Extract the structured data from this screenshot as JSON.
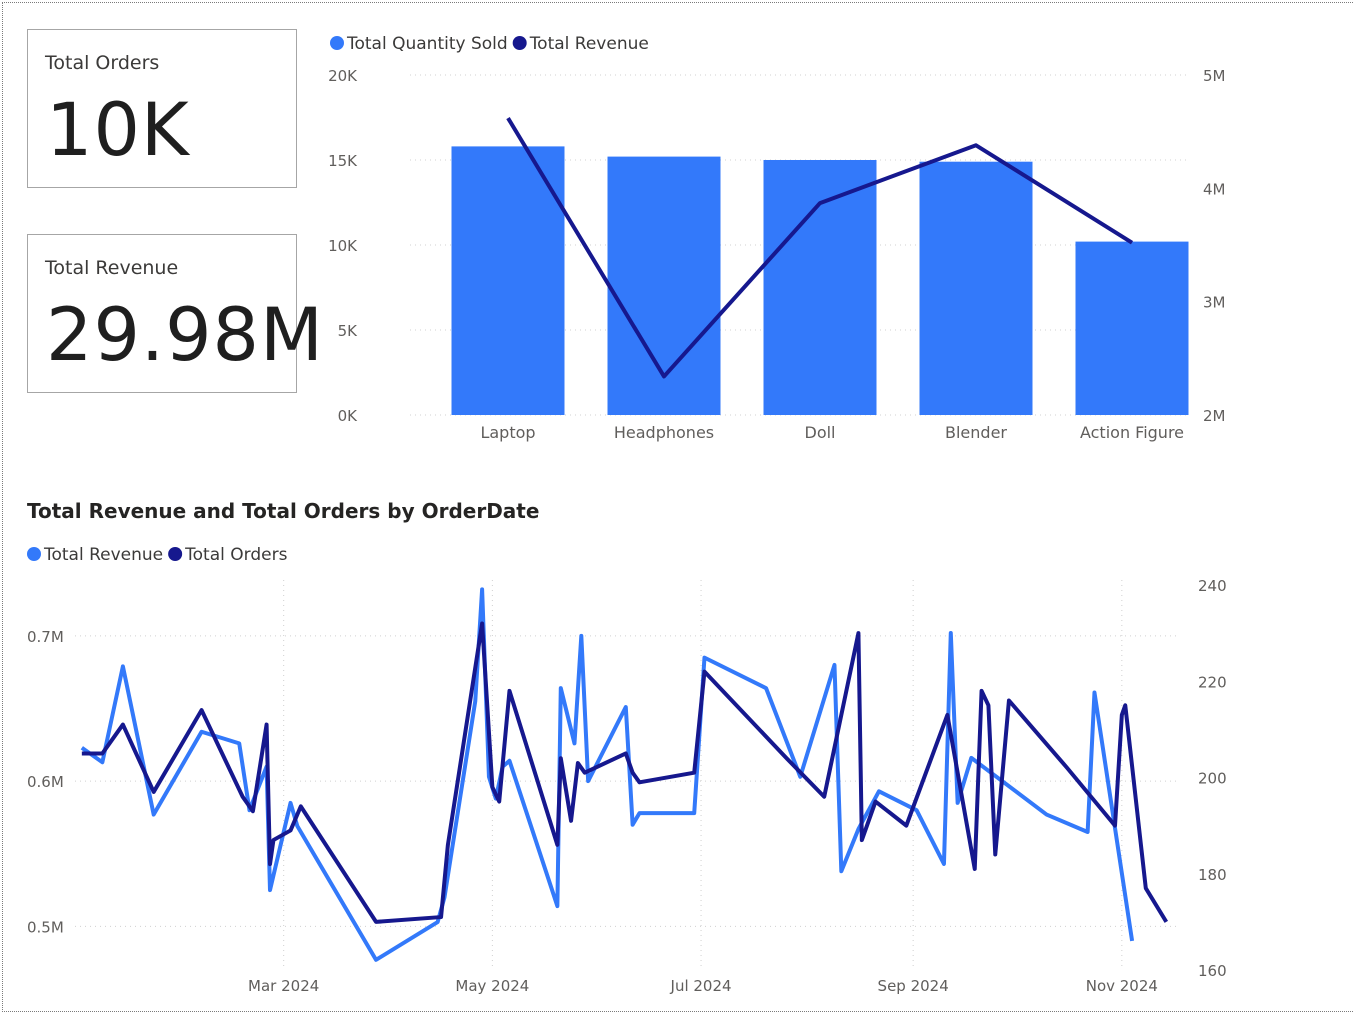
{
  "cards": {
    "orders": {
      "title": "Total Orders",
      "value": "10K"
    },
    "revenue": {
      "title": "Total Revenue",
      "value": "29.98M"
    }
  },
  "colors": {
    "light_blue": "#3379FA",
    "dark_navy": "#16188E"
  },
  "chart_data": [
    {
      "type": "bar",
      "title": "",
      "categories": [
        "Laptop",
        "Headphones",
        "Doll",
        "Blender",
        "Action Figure"
      ],
      "series": [
        {
          "name": "Total Quantity Sold",
          "type": "bar",
          "axis": "left",
          "color": "#3379FA",
          "values": [
            15800,
            15200,
            15000,
            14900,
            10200
          ]
        },
        {
          "name": "Total Revenue",
          "type": "line",
          "axis": "right",
          "color": "#16188E",
          "values": [
            4620000,
            2340000,
            3870000,
            4380000,
            3520000
          ]
        }
      ],
      "y_left": {
        "ticks": [
          "0K",
          "5K",
          "10K",
          "15K",
          "20K"
        ],
        "ylim": [
          0,
          20000
        ]
      },
      "y_right": {
        "ticks": [
          "2M",
          "3M",
          "4M",
          "5M"
        ],
        "ylim": [
          2000000,
          5000000
        ]
      },
      "legend": "top-left",
      "grid": true
    },
    {
      "type": "line",
      "title": "Total Revenue and Total Orders by OrderDate",
      "x_ticks": [
        "Mar 2024",
        "May 2024",
        "Jul 2024",
        "Sep 2024",
        "Nov 2024"
      ],
      "x_tick_dates": [
        "2024-03-01",
        "2024-05-01",
        "2024-07-01",
        "2024-09-01",
        "2024-11-01"
      ],
      "y_left": {
        "ticks": [
          "0.5M",
          "0.6M",
          "0.7M"
        ],
        "ylim": [
          0.47,
          0.735
        ],
        "unit": "M"
      },
      "y_right": {
        "ticks": [
          "160",
          "180",
          "200",
          "220",
          "240"
        ],
        "ylim": [
          160,
          240
        ]
      },
      "legend": "top-left",
      "grid": true,
      "series": [
        {
          "name": "Total Revenue",
          "axis": "left",
          "color": "#3379FA",
          "points": [
            [
              "2024-01-02",
              0.623
            ],
            [
              "2024-01-08",
              0.613
            ],
            [
              "2024-01-14",
              0.679
            ],
            [
              "2024-01-23",
              0.577
            ],
            [
              "2024-02-06",
              0.634
            ],
            [
              "2024-02-17",
              0.626
            ],
            [
              "2024-02-20",
              0.58
            ],
            [
              "2024-02-25",
              0.61
            ],
            [
              "2024-02-26",
              0.525
            ],
            [
              "2024-03-03",
              0.585
            ],
            [
              "2024-03-05",
              0.569
            ],
            [
              "2024-03-28",
              0.477
            ],
            [
              "2024-04-15",
              0.503
            ],
            [
              "2024-04-17",
              0.52
            ],
            [
              "2024-04-26",
              0.655
            ],
            [
              "2024-04-28",
              0.732
            ],
            [
              "2024-04-30",
              0.603
            ],
            [
              "2024-05-02",
              0.588
            ],
            [
              "2024-05-04",
              0.61
            ],
            [
              "2024-05-06",
              0.614
            ],
            [
              "2024-05-20",
              0.514
            ],
            [
              "2024-05-21",
              0.664
            ],
            [
              "2024-05-25",
              0.626
            ],
            [
              "2024-05-27",
              0.7
            ],
            [
              "2024-05-29",
              0.6
            ],
            [
              "2024-06-09",
              0.651
            ],
            [
              "2024-06-11",
              0.57
            ],
            [
              "2024-06-13",
              0.578
            ],
            [
              "2024-06-29",
              0.578
            ],
            [
              "2024-07-02",
              0.685
            ],
            [
              "2024-07-20",
              0.664
            ],
            [
              "2024-07-30",
              0.603
            ],
            [
              "2024-08-09",
              0.68
            ],
            [
              "2024-08-11",
              0.538
            ],
            [
              "2024-08-16",
              0.567
            ],
            [
              "2024-08-22",
              0.593
            ],
            [
              "2024-09-02",
              0.58
            ],
            [
              "2024-09-10",
              0.543
            ],
            [
              "2024-09-12",
              0.702
            ],
            [
              "2024-09-14",
              0.585
            ],
            [
              "2024-09-18",
              0.616
            ],
            [
              "2024-10-10",
              0.577
            ],
            [
              "2024-10-22",
              0.565
            ],
            [
              "2024-10-24",
              0.661
            ],
            [
              "2024-11-04",
              0.49
            ]
          ]
        },
        {
          "name": "Total Orders",
          "axis": "right",
          "color": "#16188E",
          "points": [
            [
              "2024-01-02",
              205
            ],
            [
              "2024-01-08",
              205
            ],
            [
              "2024-01-14",
              211
            ],
            [
              "2024-01-23",
              197
            ],
            [
              "2024-02-06",
              214
            ],
            [
              "2024-02-18",
              196
            ],
            [
              "2024-02-21",
              193
            ],
            [
              "2024-02-25",
              211
            ],
            [
              "2024-02-26",
              182
            ],
            [
              "2024-02-27",
              187
            ],
            [
              "2024-03-03",
              189
            ],
            [
              "2024-03-06",
              194
            ],
            [
              "2024-03-28",
              170
            ],
            [
              "2024-04-16",
              171
            ],
            [
              "2024-04-18",
              186
            ],
            [
              "2024-04-28",
              232
            ],
            [
              "2024-05-01",
              198
            ],
            [
              "2024-05-03",
              195
            ],
            [
              "2024-05-06",
              218
            ],
            [
              "2024-05-20",
              186
            ],
            [
              "2024-05-21",
              204
            ],
            [
              "2024-05-24",
              191
            ],
            [
              "2024-05-26",
              203
            ],
            [
              "2024-05-28",
              201
            ],
            [
              "2024-06-09",
              205
            ],
            [
              "2024-06-11",
              201
            ],
            [
              "2024-06-13",
              199
            ],
            [
              "2024-06-29",
              201
            ],
            [
              "2024-07-02",
              222
            ],
            [
              "2024-07-26",
              204
            ],
            [
              "2024-08-06",
              196
            ],
            [
              "2024-08-16",
              230
            ],
            [
              "2024-08-17",
              187
            ],
            [
              "2024-08-21",
              195
            ],
            [
              "2024-08-30",
              190
            ],
            [
              "2024-09-11",
              213
            ],
            [
              "2024-09-19",
              181
            ],
            [
              "2024-09-21",
              218
            ],
            [
              "2024-09-23",
              215
            ],
            [
              "2024-09-25",
              184
            ],
            [
              "2024-09-29",
              216
            ],
            [
              "2024-10-16",
              202
            ],
            [
              "2024-10-30",
              190
            ],
            [
              "2024-11-01",
              213
            ],
            [
              "2024-11-02",
              215
            ],
            [
              "2024-11-08",
              177
            ],
            [
              "2024-11-14",
              170
            ]
          ]
        }
      ]
    }
  ]
}
